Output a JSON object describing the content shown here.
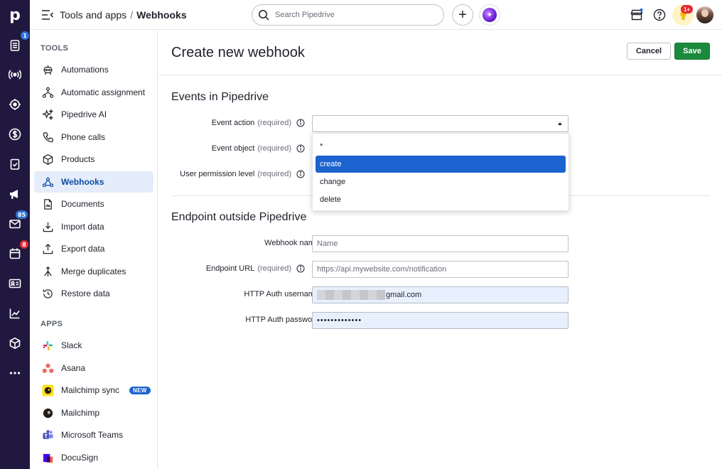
{
  "topbar": {
    "breadcrumb_parent": "Tools and apps",
    "breadcrumb_separator": "/",
    "breadcrumb_current": "Webhooks",
    "search_placeholder": "Search Pipedrive",
    "notification_badge": "1+"
  },
  "rail": {
    "logo": "p",
    "badges": {
      "deals": "1",
      "mail": "85",
      "calendar": "8"
    }
  },
  "sidebar": {
    "tools_heading": "TOOLS",
    "apps_heading": "APPS",
    "tools": [
      {
        "label": "Automations",
        "icon": "automations-icon"
      },
      {
        "label": "Automatic assignment",
        "icon": "assignment-icon"
      },
      {
        "label": "Pipedrive AI",
        "icon": "sparkle-icon"
      },
      {
        "label": "Phone calls",
        "icon": "phone-icon"
      },
      {
        "label": "Products",
        "icon": "box-icon"
      },
      {
        "label": "Webhooks",
        "icon": "webhook-icon",
        "active": true
      },
      {
        "label": "Documents",
        "icon": "document-icon"
      },
      {
        "label": "Import data",
        "icon": "import-icon"
      },
      {
        "label": "Export data",
        "icon": "export-icon"
      },
      {
        "label": "Merge duplicates",
        "icon": "merge-icon"
      },
      {
        "label": "Restore data",
        "icon": "restore-icon"
      }
    ],
    "apps": [
      {
        "label": "Slack",
        "icon": "slack-icon"
      },
      {
        "label": "Asana",
        "icon": "asana-icon"
      },
      {
        "label": "Mailchimp sync",
        "icon": "mailchimp-icon",
        "badge": "NEW"
      },
      {
        "label": "Mailchimp",
        "icon": "mailchimp-icon"
      },
      {
        "label": "Microsoft Teams",
        "icon": "teams-icon"
      },
      {
        "label": "DocuSign",
        "icon": "docusign-icon"
      }
    ]
  },
  "main": {
    "title": "Create new webhook",
    "cancel_label": "Cancel",
    "save_label": "Save",
    "events_section": "Events in Pipedrive",
    "endpoint_section": "Endpoint outside Pipedrive",
    "required_text": "(required)",
    "fields": {
      "event_action": {
        "label": "Event action",
        "value": ""
      },
      "event_object": {
        "label": "Event object"
      },
      "user_permission": {
        "label": "User permission level"
      },
      "webhook_name": {
        "label": "Webhook name",
        "placeholder": "Name"
      },
      "endpoint_url": {
        "label": "Endpoint URL",
        "placeholder": "https://api.mywebsite.com/notification"
      },
      "http_user": {
        "label": "HTTP Auth username",
        "value": "gmail.com"
      },
      "http_password": {
        "label": "HTTP Auth password",
        "value": "•••••••••••••"
      }
    },
    "dropdown_options": [
      "*",
      "create",
      "change",
      "delete"
    ],
    "dropdown_selected": "create"
  },
  "colors": {
    "rail_bg": "#21183f",
    "accent": "#1c63cf",
    "save_green": "#1b8a3c",
    "active_bg": "#e5edfa"
  }
}
